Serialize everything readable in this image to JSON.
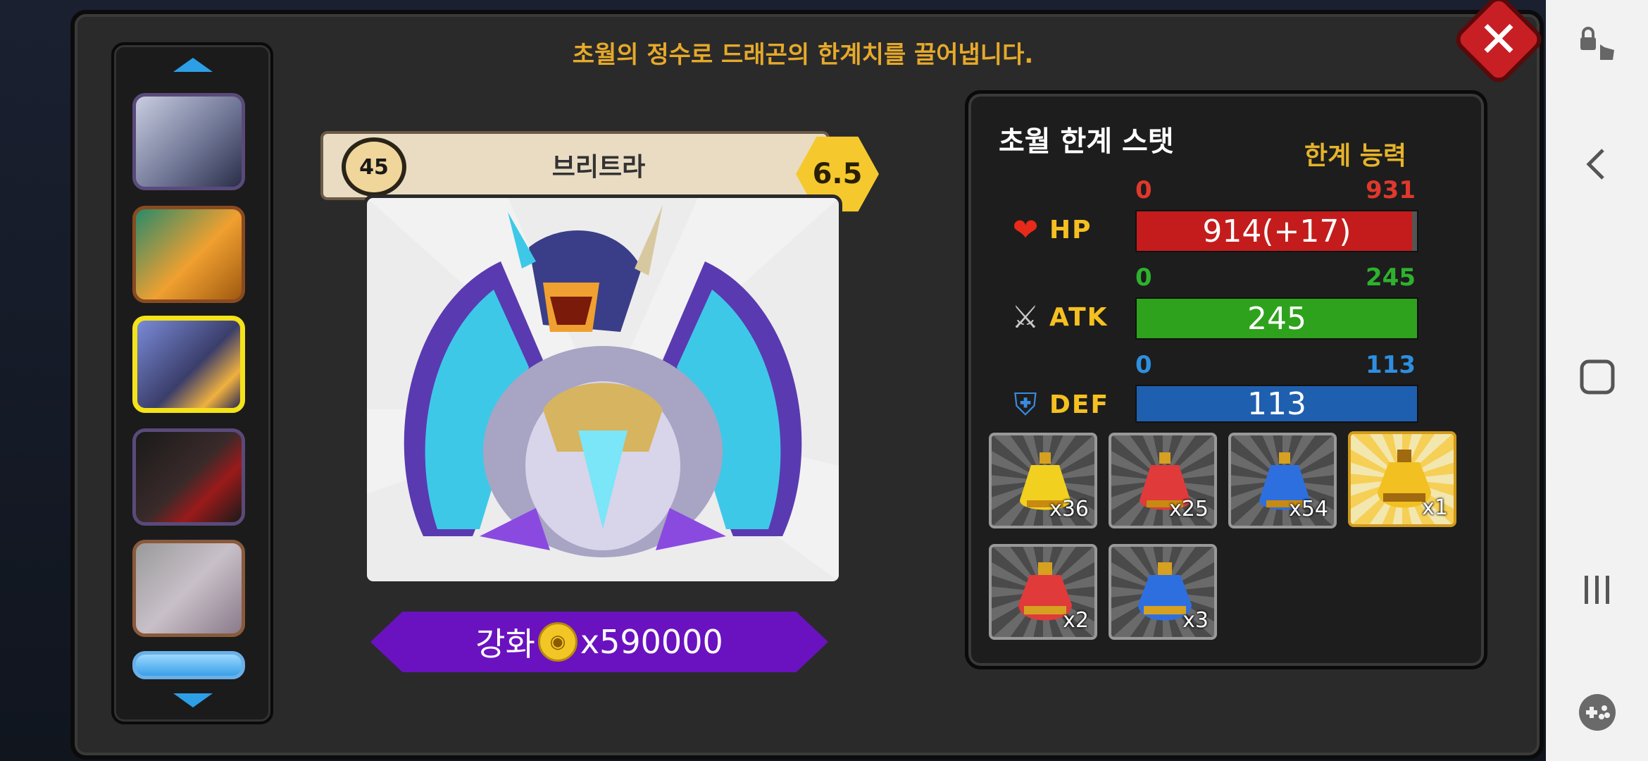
{
  "header": {
    "title": "초월의 정수로 드래곤의 한계치를 끌어냅니다."
  },
  "dragon": {
    "level": "45",
    "name": "브리트라",
    "grade": "6.5"
  },
  "upgrade": {
    "label": "강화",
    "cost": "x590000"
  },
  "stats_panel": {
    "title": "초월 한계 스탯",
    "limit_label": "한계 능력",
    "stats": [
      {
        "label": "HP",
        "min": "0",
        "max": "931",
        "value": "914(+17)",
        "fill": 0.982,
        "color": "#c41c1c",
        "minmax_color": "#e0382c"
      },
      {
        "label": "ATK",
        "min": "0",
        "max": "245",
        "value": "245",
        "fill": 1.0,
        "color": "#2ea21c",
        "minmax_color": "#2eb12e"
      },
      {
        "label": "DEF",
        "min": "0",
        "max": "113",
        "value": "113",
        "fill": 1.0,
        "color": "#1f5fb0",
        "minmax_color": "#2e8fe0"
      }
    ]
  },
  "items": [
    {
      "count": "x36",
      "color": "#f2d020"
    },
    {
      "count": "x25",
      "color": "#e03a3a"
    },
    {
      "count": "x54",
      "color": "#2e6fe0"
    },
    {
      "count": "x1",
      "color": "#f2c020"
    },
    {
      "count": "x2",
      "color": "#e03a3a"
    },
    {
      "count": "x3",
      "color": "#2e6fe0"
    }
  ],
  "system_nav": {
    "icons": [
      "touch-lock-icon",
      "back-icon",
      "home-icon",
      "recents-icon",
      "game-tools-icon"
    ]
  }
}
